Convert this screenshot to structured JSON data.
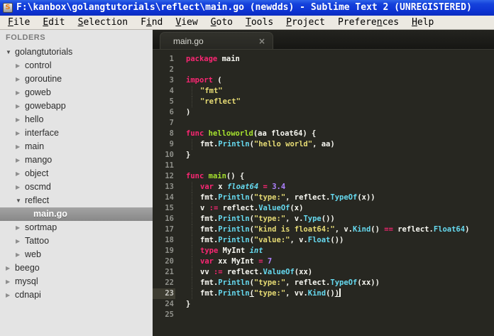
{
  "window": {
    "title": "F:\\kanbox\\golangtutorials\\reflect\\main.go (newdds) - Sublime Text 2 (UNREGISTERED)",
    "icon_letter": "S"
  },
  "menu": {
    "items": [
      {
        "label": "File",
        "accel": 0
      },
      {
        "label": "Edit",
        "accel": 0
      },
      {
        "label": "Selection",
        "accel": 0
      },
      {
        "label": "Find",
        "accel": 1
      },
      {
        "label": "View",
        "accel": 0
      },
      {
        "label": "Goto",
        "accel": 0
      },
      {
        "label": "Tools",
        "accel": 0
      },
      {
        "label": "Project",
        "accel": 0
      },
      {
        "label": "Preferences",
        "accel": 7
      },
      {
        "label": "Help",
        "accel": 0
      }
    ]
  },
  "sidebar": {
    "header": "FOLDERS",
    "tree": [
      {
        "label": "golangtutorials",
        "level": 0,
        "state": "expanded",
        "selected": false
      },
      {
        "label": "control",
        "level": 1,
        "state": "collapsed",
        "selected": false
      },
      {
        "label": "goroutine",
        "level": 1,
        "state": "collapsed",
        "selected": false
      },
      {
        "label": "goweb",
        "level": 1,
        "state": "collapsed",
        "selected": false
      },
      {
        "label": "gowebapp",
        "level": 1,
        "state": "collapsed",
        "selected": false
      },
      {
        "label": "hello",
        "level": 1,
        "state": "collapsed",
        "selected": false
      },
      {
        "label": "interface",
        "level": 1,
        "state": "collapsed",
        "selected": false
      },
      {
        "label": "main",
        "level": 1,
        "state": "collapsed",
        "selected": false
      },
      {
        "label": "mango",
        "level": 1,
        "state": "collapsed",
        "selected": false
      },
      {
        "label": "object",
        "level": 1,
        "state": "collapsed",
        "selected": false
      },
      {
        "label": "oscmd",
        "level": 1,
        "state": "collapsed",
        "selected": false
      },
      {
        "label": "reflect",
        "level": 1,
        "state": "expanded",
        "selected": false
      },
      {
        "label": "main.go",
        "level": 2,
        "state": "file",
        "selected": true
      },
      {
        "label": "sortmap",
        "level": 1,
        "state": "collapsed",
        "selected": false
      },
      {
        "label": "Tattoo",
        "level": 1,
        "state": "collapsed",
        "selected": false
      },
      {
        "label": "web",
        "level": 1,
        "state": "collapsed",
        "selected": false
      },
      {
        "label": "beego",
        "level": 0,
        "state": "collapsed",
        "selected": false
      },
      {
        "label": "mysql",
        "level": 0,
        "state": "collapsed",
        "selected": false
      },
      {
        "label": "cdnapi",
        "level": 0,
        "state": "collapsed",
        "selected": false
      }
    ]
  },
  "tabs": {
    "active_label": "main.go",
    "close_glyph": "×"
  },
  "editor": {
    "current_line": 23,
    "colors": {
      "background": "#272721",
      "keyword": "#f92672",
      "function_name": "#a6e22e",
      "string": "#e6db74",
      "number": "#ae81ff",
      "type_italic": "#66d9ef",
      "method": "#66d9ef",
      "default_text": "#f8f8f2",
      "gutter": "#8f908a",
      "titlebar_blue": "#0d33d2",
      "sidebar_bg": "#e4e4e4"
    },
    "lines": [
      {
        "no": 1,
        "indent": 0,
        "segments": [
          [
            "package",
            "k"
          ],
          [
            " main",
            "w"
          ]
        ]
      },
      {
        "no": 2,
        "indent": 0,
        "segments": []
      },
      {
        "no": 3,
        "indent": 0,
        "segments": [
          [
            "import",
            "k"
          ],
          [
            " (",
            "w"
          ]
        ]
      },
      {
        "no": 4,
        "indent": 1,
        "segments": [
          [
            "\"fmt\"",
            "s"
          ]
        ]
      },
      {
        "no": 5,
        "indent": 1,
        "segments": [
          [
            "\"reflect\"",
            "s"
          ]
        ]
      },
      {
        "no": 6,
        "indent": 0,
        "segments": [
          [
            ")",
            "w"
          ]
        ]
      },
      {
        "no": 7,
        "indent": 0,
        "segments": []
      },
      {
        "no": 8,
        "indent": 0,
        "segments": [
          [
            "func",
            "k"
          ],
          [
            " ",
            "w"
          ],
          [
            "helloworld",
            "fn"
          ],
          [
            "(aa float64) {",
            "w"
          ]
        ]
      },
      {
        "no": 9,
        "indent": 1,
        "segments": [
          [
            "fmt.",
            "w"
          ],
          [
            "Println",
            "m"
          ],
          [
            "(",
            "w"
          ],
          [
            "\"hello world\"",
            "s"
          ],
          [
            ", aa)",
            "w"
          ]
        ]
      },
      {
        "no": 10,
        "indent": 0,
        "segments": [
          [
            "}",
            "w"
          ]
        ]
      },
      {
        "no": 11,
        "indent": 0,
        "segments": []
      },
      {
        "no": 12,
        "indent": 0,
        "segments": [
          [
            "func",
            "k"
          ],
          [
            " ",
            "w"
          ],
          [
            "main",
            "fn"
          ],
          [
            "() {",
            "w"
          ]
        ]
      },
      {
        "no": 13,
        "indent": 1,
        "segments": [
          [
            "var",
            "k"
          ],
          [
            " x ",
            "w"
          ],
          [
            "float64",
            "t"
          ],
          [
            " ",
            "w"
          ],
          [
            "=",
            "k"
          ],
          [
            " ",
            "w"
          ],
          [
            "3.4",
            "n"
          ]
        ]
      },
      {
        "no": 14,
        "indent": 1,
        "segments": [
          [
            "fmt.",
            "w"
          ],
          [
            "Println",
            "m"
          ],
          [
            "(",
            "w"
          ],
          [
            "\"type:\"",
            "s"
          ],
          [
            ", reflect.",
            "w"
          ],
          [
            "TypeOf",
            "m"
          ],
          [
            "(x))",
            "w"
          ]
        ]
      },
      {
        "no": 15,
        "indent": 1,
        "segments": [
          [
            "v ",
            "w"
          ],
          [
            ":=",
            "k"
          ],
          [
            " reflect.",
            "w"
          ],
          [
            "ValueOf",
            "m"
          ],
          [
            "(x)",
            "w"
          ]
        ]
      },
      {
        "no": 16,
        "indent": 1,
        "segments": [
          [
            "fmt.",
            "w"
          ],
          [
            "Println",
            "m"
          ],
          [
            "(",
            "w"
          ],
          [
            "\"type:\"",
            "s"
          ],
          [
            ", v.",
            "w"
          ],
          [
            "Type",
            "m"
          ],
          [
            "())",
            "w"
          ]
        ]
      },
      {
        "no": 17,
        "indent": 1,
        "segments": [
          [
            "fmt.",
            "w"
          ],
          [
            "Println",
            "m"
          ],
          [
            "(",
            "w"
          ],
          [
            "\"kind is float64:\"",
            "s"
          ],
          [
            ", v.",
            "w"
          ],
          [
            "Kind",
            "m"
          ],
          [
            "() ",
            "w"
          ],
          [
            "==",
            "k"
          ],
          [
            " reflect.",
            "w"
          ],
          [
            "Float64",
            "m"
          ],
          [
            ")",
            "w"
          ]
        ]
      },
      {
        "no": 18,
        "indent": 1,
        "segments": [
          [
            "fmt.",
            "w"
          ],
          [
            "Println",
            "m"
          ],
          [
            "(",
            "w"
          ],
          [
            "\"value:\"",
            "s"
          ],
          [
            ", v.",
            "w"
          ],
          [
            "Float",
            "m"
          ],
          [
            "())",
            "w"
          ]
        ]
      },
      {
        "no": 19,
        "indent": 1,
        "segments": [
          [
            "type",
            "k"
          ],
          [
            " MyInt ",
            "w"
          ],
          [
            "int",
            "t"
          ]
        ]
      },
      {
        "no": 20,
        "indent": 1,
        "segments": [
          [
            "var",
            "k"
          ],
          [
            " xx MyInt ",
            "w"
          ],
          [
            "=",
            "k"
          ],
          [
            " ",
            "w"
          ],
          [
            "7",
            "n"
          ]
        ]
      },
      {
        "no": 21,
        "indent": 1,
        "segments": [
          [
            "vv ",
            "w"
          ],
          [
            ":=",
            "k"
          ],
          [
            " reflect.",
            "w"
          ],
          [
            "ValueOf",
            "m"
          ],
          [
            "(xx)",
            "w"
          ]
        ]
      },
      {
        "no": 22,
        "indent": 1,
        "segments": [
          [
            "fmt.",
            "w"
          ],
          [
            "Println",
            "m"
          ],
          [
            "(",
            "w"
          ],
          [
            "\"type:\"",
            "s"
          ],
          [
            ", reflect.",
            "w"
          ],
          [
            "TypeOf",
            "m"
          ],
          [
            "(xx))",
            "w"
          ]
        ]
      },
      {
        "no": 23,
        "indent": 1,
        "caret": true,
        "segments": [
          [
            "fmt.",
            "w"
          ],
          [
            "Println",
            "m"
          ],
          [
            "(",
            "wu"
          ],
          [
            "\"type:\"",
            "s"
          ],
          [
            ", vv.",
            "w"
          ],
          [
            "Kind",
            "m"
          ],
          [
            "()",
            "w"
          ],
          [
            ")",
            "wu"
          ]
        ]
      },
      {
        "no": 24,
        "indent": 0,
        "segments": [
          [
            "}",
            "w"
          ]
        ]
      },
      {
        "no": 25,
        "indent": 0,
        "segments": []
      }
    ]
  }
}
